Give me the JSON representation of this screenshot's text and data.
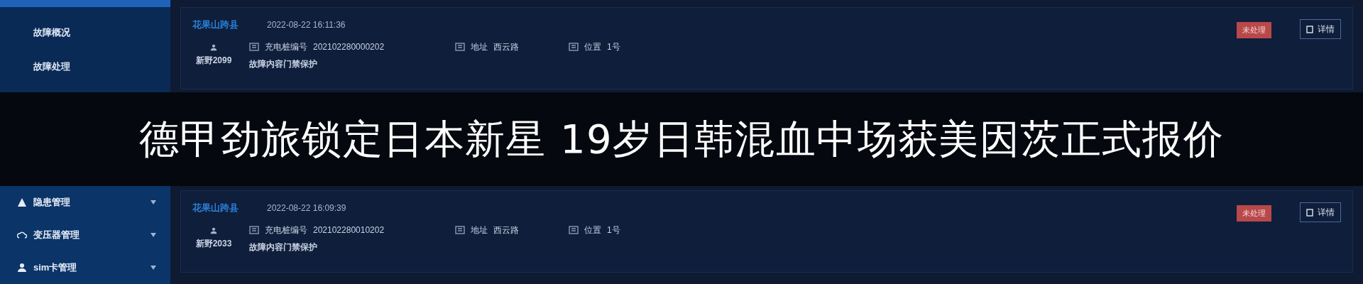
{
  "upper": {
    "sidebar_items": [
      {
        "kind": "sub",
        "label": "故障概况"
      },
      {
        "kind": "sub",
        "label": "故障处理"
      }
    ],
    "records": [
      {
        "site": "花果山跨县",
        "time": "2022-08-22 16:11:36",
        "user": "新野2099",
        "pile_label": "充电桩编号",
        "pile_no": "202102280000202",
        "address_label": "地址",
        "address": "西云路",
        "position_label": "位置",
        "position": "1号",
        "content": "故障内容门禁保护",
        "status": "未处理",
        "detail": "详情"
      }
    ]
  },
  "caption": "德甲劲旅锁定日本新星 19岁日韩混血中场获美因茨正式报价",
  "lower": {
    "sidebar_items": [
      {
        "kind": "group",
        "label": "隐患管理"
      },
      {
        "kind": "group",
        "label": "变压器管理"
      },
      {
        "kind": "group",
        "label": "sim卡管理"
      }
    ],
    "records": [
      {
        "site": "花果山跨县",
        "time": "2022-08-22 16:09:39",
        "user": "新野2033",
        "pile_label": "充电桩编号",
        "pile_no": "202102280010202",
        "address_label": "地址",
        "address": "西云路",
        "position_label": "位置",
        "position": "1号",
        "content": "故障内容门禁保护",
        "status": "未处理",
        "detail": "详情"
      }
    ]
  }
}
